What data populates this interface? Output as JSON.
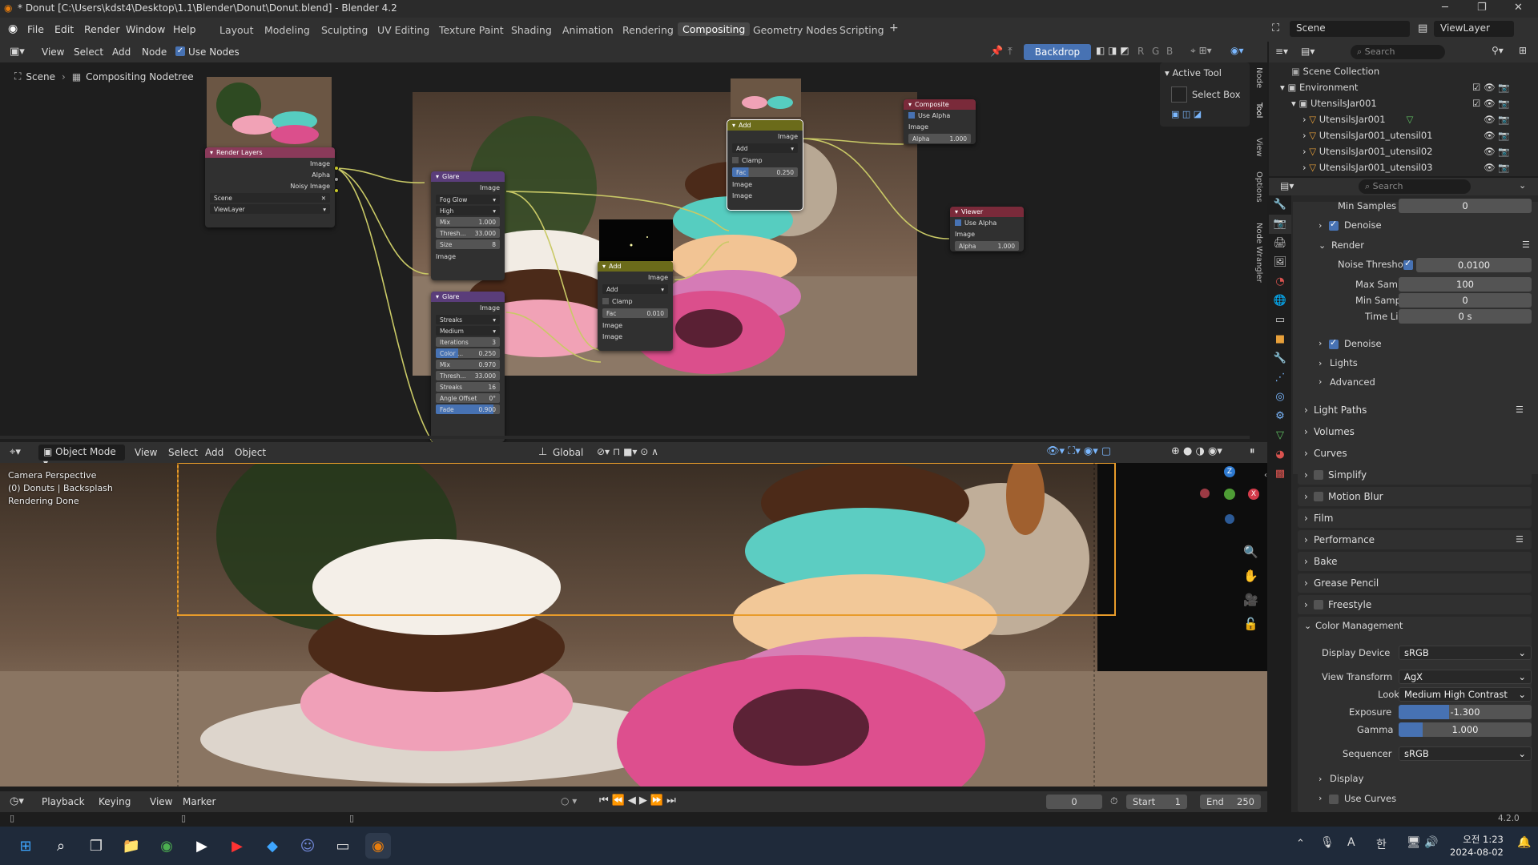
{
  "window": {
    "title": "* Donut [C:\\Users\\kdst4\\Desktop\\1.1\\Blender\\Donut\\Donut.blend] - Blender 4.2"
  },
  "menu": [
    "File",
    "Edit",
    "Render",
    "Window",
    "Help"
  ],
  "workspaces": [
    "Layout",
    "Modeling",
    "Sculpting",
    "UV Editing",
    "Texture Paint",
    "Shading",
    "Animation",
    "Rendering",
    "Compositing",
    "Geometry Nodes",
    "Scripting"
  ],
  "active_workspace": "Compositing",
  "scene": {
    "label": "Scene",
    "view_layer": "ViewLayer"
  },
  "node_editor": {
    "menus": [
      "View",
      "Select",
      "Add",
      "Node"
    ],
    "use_nodes": "Use Nodes",
    "backdrop": "Backdrop",
    "channels": [
      "R",
      "G",
      "B"
    ],
    "breadcrumb": [
      "Scene",
      "Compositing Nodetree"
    ],
    "active_tool": "Active Tool",
    "select_box": "Select Box",
    "side_tabs": [
      "Node",
      "Tool",
      "View",
      "Options",
      "Node Wrangler"
    ]
  },
  "nodes": {
    "render_layers": {
      "title": "Render Layers",
      "outputs": [
        "Image",
        "Alpha",
        "Noisy Image"
      ],
      "scene": "Scene",
      "layer": "ViewLayer"
    },
    "glare1": {
      "title": "Glare",
      "output": "Image",
      "type": "Fog Glow",
      "quality": "High",
      "mix_label": "Mix",
      "mix": "1.000",
      "thresh_label": "Thresh...",
      "thresh": "33.000",
      "size_label": "Size",
      "size": "8",
      "input": "Image"
    },
    "glare2": {
      "title": "Glare",
      "output": "Image",
      "type": "Streaks",
      "quality": "Medium",
      "iter_label": "Iterations",
      "iter": "3",
      "color_label": "Color ...",
      "color": "0.250",
      "mix_label": "Mix",
      "mix": "0.970",
      "thresh_label": "Thresh...",
      "thresh": "33.000",
      "streaks_label": "Streaks",
      "streaks": "16",
      "angle_label": "Angle Offset",
      "angle": "0°",
      "fade_label": "Fade",
      "fade": "0.900"
    },
    "add1": {
      "title": "Add",
      "output": "Image",
      "mode": "Add",
      "clamp": "Clamp",
      "fac_label": "Fac",
      "fac": "0.010",
      "inputs": [
        "Image",
        "Image"
      ]
    },
    "add2": {
      "title": "Add",
      "output": "Image",
      "mode": "Add",
      "clamp": "Clamp",
      "fac_label": "Fac",
      "fac": "0.250",
      "inputs": [
        "Image",
        "Image"
      ]
    },
    "composite": {
      "title": "Composite",
      "use_alpha": "Use Alpha",
      "input": "Image",
      "alpha_label": "Alpha",
      "alpha": "1.000"
    },
    "viewer": {
      "title": "Viewer",
      "use_alpha": "Use Alpha",
      "input": "Image",
      "alpha_label": "Alpha",
      "alpha": "1.000"
    }
  },
  "viewport": {
    "mode": "Object Mode",
    "menus": [
      "View",
      "Select",
      "Add",
      "Object"
    ],
    "orientation": "Global",
    "overlay_lines": [
      "Camera Perspective",
      "(0) Donuts | Backsplash",
      "Rendering Done"
    ],
    "gizmo_axes": [
      "Z",
      "X"
    ]
  },
  "timeline": {
    "menus": [
      "Playback",
      "Keying",
      "View",
      "Marker"
    ],
    "frame": "0",
    "start_label": "Start",
    "start": "1",
    "end_label": "End",
    "end": "250"
  },
  "outliner": {
    "search_placeholder": "Search",
    "root": "Scene Collection",
    "items": [
      "Environment",
      "UtensilsJar001",
      "UtensilsJar001",
      "UtensilsJar001_utensil01",
      "UtensilsJar001_utensil02",
      "UtensilsJar001_utensil03"
    ]
  },
  "properties": {
    "search_placeholder": "Search",
    "min_samples_top_label": "Min Samples",
    "min_samples_top": "0",
    "denoise1": "Denoise",
    "render_label": "Render",
    "noise_threshold_label": "Noise Threshold",
    "noise_threshold": "0.0100",
    "max_samples_label": "Max Samples",
    "max_samples": "100",
    "min_samples_label": "Min Samples",
    "min_samples": "0",
    "time_limit_label": "Time Limit",
    "time_limit": "0 s",
    "denoise2": "Denoise",
    "lights": "Lights",
    "advanced": "Advanced",
    "sections": [
      "Light Paths",
      "Volumes",
      "Curves",
      "Simplify",
      "Motion Blur",
      "Film",
      "Performance",
      "Bake",
      "Grease Pencil",
      "Freestyle"
    ],
    "color_management": "Color Management",
    "display_device_label": "Display Device",
    "display_device": "sRGB",
    "view_transform_label": "View Transform",
    "view_transform": "AgX",
    "look_label": "Look",
    "look": "Medium High Contrast",
    "exposure_label": "Exposure",
    "exposure": "-1.300",
    "gamma_label": "Gamma",
    "gamma": "1.000",
    "sequencer_label": "Sequencer",
    "sequencer": "sRGB",
    "display": "Display",
    "use_curves": "Use Curves"
  },
  "status": {
    "version": "4.2.0"
  },
  "taskbar": {
    "time": "오전 1:23",
    "date": "2024-08-02",
    "ime": "A",
    "ime2": "한"
  }
}
